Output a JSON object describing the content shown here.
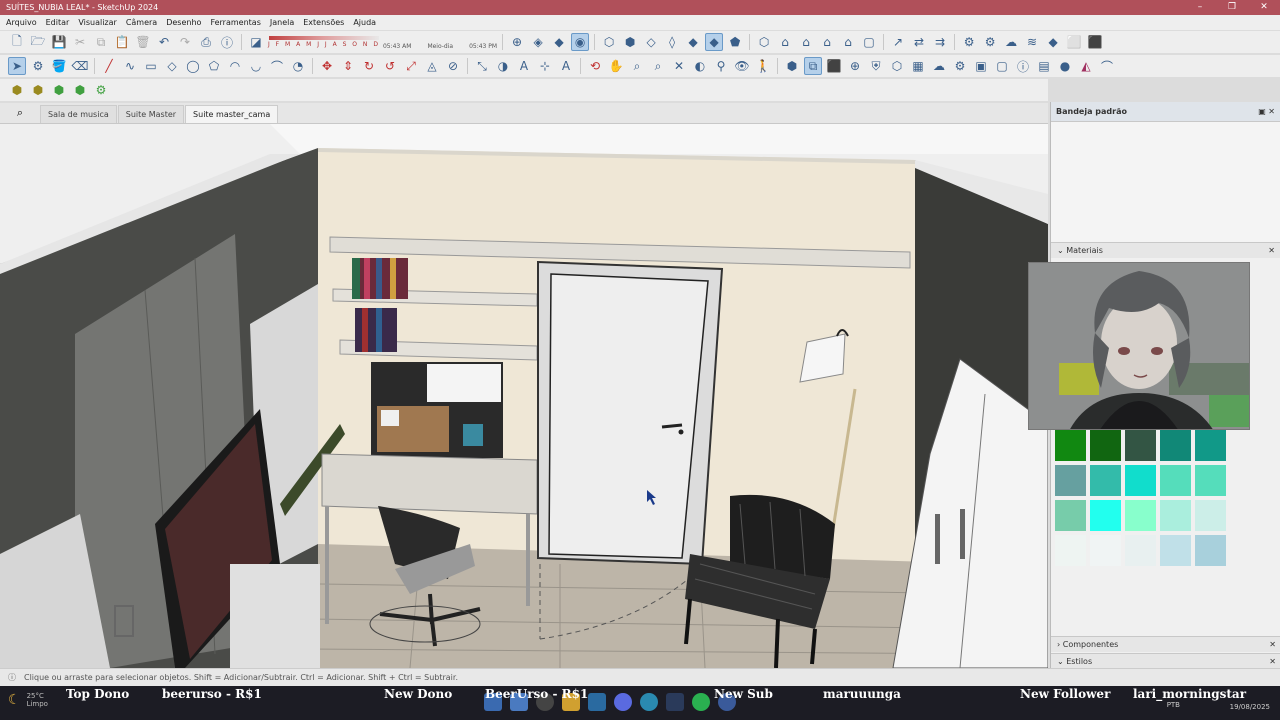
{
  "window": {
    "title": "SUÍTES_NUBIA LEAL* - SketchUp 2024"
  },
  "menu": [
    "Arquivo",
    "Editar",
    "Visualizar",
    "Câmera",
    "Desenho",
    "Ferramentas",
    "Janela",
    "Extensões",
    "Ajuda"
  ],
  "shadows": {
    "months": "J F M A M J J A S O N D",
    "time_start": "05:43 AM",
    "time_mid": "Meio-dia",
    "time_end": "05:43 PM"
  },
  "scene_tabs": [
    {
      "label": "Sala de musica",
      "active": false
    },
    {
      "label": "Suite Master",
      "active": false
    },
    {
      "label": "Suite master_cama",
      "active": true
    }
  ],
  "tray": {
    "title": "Bandeja padrão",
    "materials_label": "Materiais",
    "components_label": "Componentes",
    "styles_label": "Estilos",
    "swatch_colors": [
      "#8ee28e",
      "#8ee28e",
      "#44dd44",
      "#22ff77",
      "#22ff99",
      "#90b890",
      "#44bb66",
      "#339955",
      "#339933",
      "#118811",
      "#116611",
      "#335544",
      "#118877",
      "#119988",
      "#66a0a0",
      "#33bbaa",
      "#11ddcc",
      "#55ddbb",
      "#55ddbb",
      "#77ccaa",
      "#22ffee",
      "#88ffcc",
      "#aaeedd",
      "#cceee8",
      "#eef4f2",
      "#f0f4f4",
      "#e8f0f0",
      "#c0e0e8",
      "#a8d0dc"
    ]
  },
  "status": {
    "hint": "Clique ou arraste para selecionar objetos. Shift = Adicionar/Subtrair. Ctrl = Adicionar. Shift + Ctrl = Subtrair."
  },
  "ticker": {
    "top_dono_label": "Top Dono",
    "top_dono_value": "beerurso - R$1",
    "new_dono_label": "New Dono",
    "new_dono_value": "BeerUrso - R$1",
    "new_sub_label": "New Sub",
    "new_sub_value": "maruuunga",
    "new_follower_label": "New Follower",
    "new_follower_value": "lari_morningstar"
  },
  "taskbar": {
    "temp": "25°C",
    "weather": "Limpo",
    "lang": "PTB",
    "date": "19/08/2025"
  },
  "colors": {
    "title_bg": "#b0505a",
    "accent": "#3a5f8a"
  }
}
